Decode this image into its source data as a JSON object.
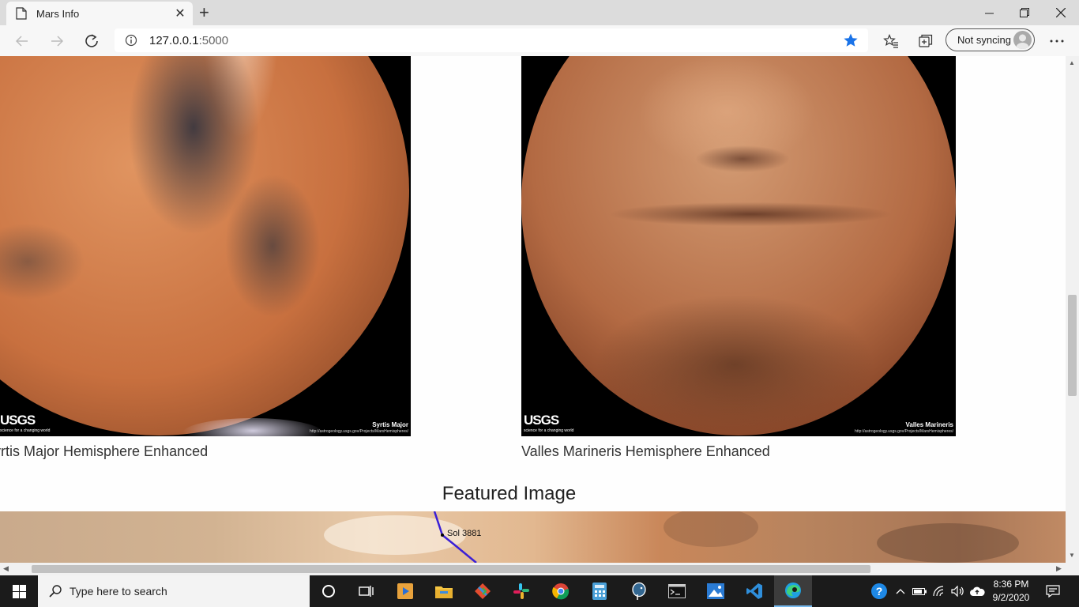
{
  "browser": {
    "tab_title": "Mars Info",
    "new_tab": "+",
    "url_host": "127.0.0.1",
    "url_port": ":5000",
    "profile_text": "Not syncing",
    "window_controls": [
      "minimize-icon",
      "restore-icon",
      "close-icon"
    ]
  },
  "page": {
    "hemispheres": [
      {
        "caption": "Syrtis Major Hemisphere Enhanced",
        "image_label": "Syrtis Major",
        "image_url_text": "http://astrogeology.usgs.gov/Projects/MarsHemispheres/",
        "logo_text": "USGS",
        "logo_tagline": "science for a changing world"
      },
      {
        "caption": "Valles Marineris Hemisphere Enhanced",
        "image_label": "Valles Marineris",
        "image_url_text": "http://astrogeology.usgs.gov/Projects/MarsHemispheres/",
        "logo_text": "USGS",
        "logo_tagline": "science for a changing world"
      }
    ],
    "featured_heading": "Featured Image",
    "featured_label": "Sol 3881"
  },
  "taskbar": {
    "search_placeholder": "Type here to search",
    "time": "8:36 PM",
    "date": "9/2/2020",
    "pinned_apps": [
      "cortana-icon",
      "task-view-icon",
      "media-player-icon",
      "file-explorer-icon",
      "git-icon",
      "slack-icon",
      "chrome-icon",
      "calculator-icon",
      "postgres-icon",
      "terminal-icon",
      "photos-icon",
      "vscode-icon",
      "edge-icon"
    ]
  },
  "colors": {
    "accent_star": "#1a73e8",
    "taskbar_bg": "#1b1b1b",
    "active_underline": "#76b9ed"
  }
}
